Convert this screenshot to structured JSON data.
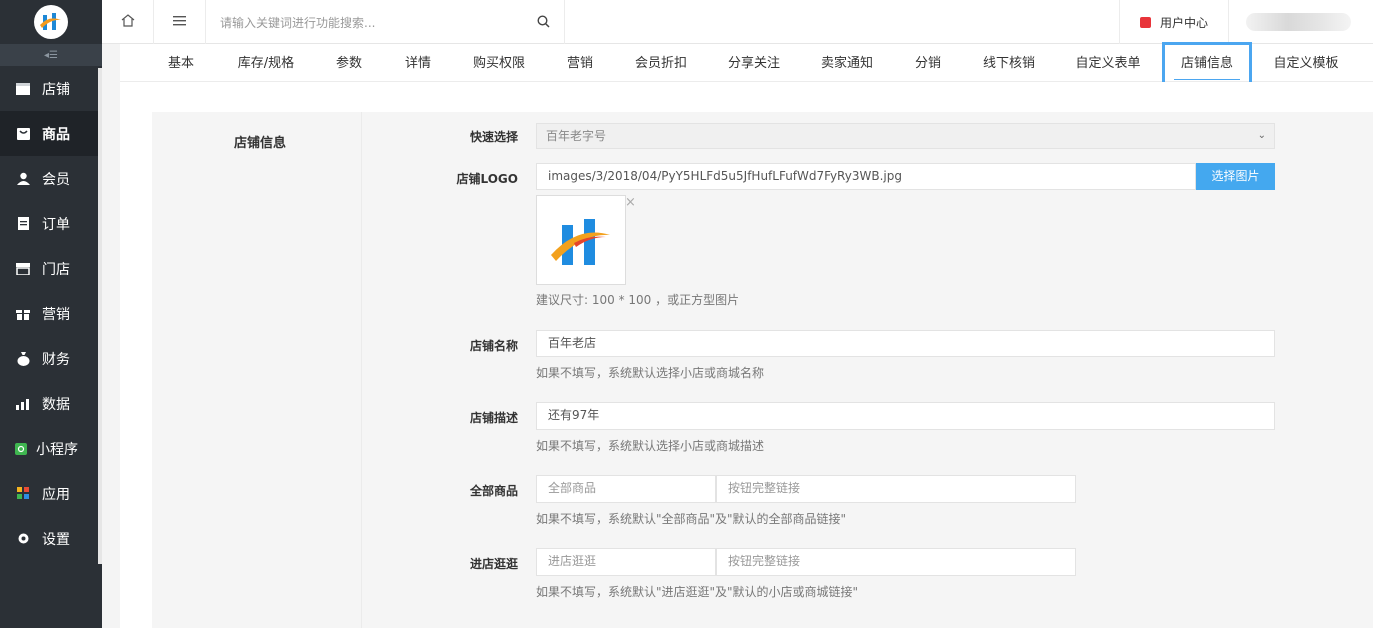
{
  "sidebar": {
    "collapse_icon": "collapse-icon",
    "items": [
      {
        "label": "店铺",
        "icon": "store-icon"
      },
      {
        "label": "商品",
        "icon": "goods-icon",
        "active": true
      },
      {
        "label": "会员",
        "icon": "member-icon"
      },
      {
        "label": "订单",
        "icon": "order-icon"
      },
      {
        "label": "门店",
        "icon": "shop-icon"
      },
      {
        "label": "营销",
        "icon": "gift-icon"
      },
      {
        "label": "财务",
        "icon": "money-bag-icon"
      },
      {
        "label": "数据",
        "icon": "bar-chart-icon"
      },
      {
        "label": "小程序",
        "icon": "mini-program-icon"
      },
      {
        "label": "应用",
        "icon": "apps-icon"
      },
      {
        "label": "设置",
        "icon": "gear-icon"
      }
    ]
  },
  "topbar": {
    "search_placeholder": "请输入关键词进行功能搜索...",
    "user_center_label": "用户中心"
  },
  "tabs": [
    {
      "label": "基本"
    },
    {
      "label": "库存/规格"
    },
    {
      "label": "参数"
    },
    {
      "label": "详情"
    },
    {
      "label": "购买权限"
    },
    {
      "label": "营销"
    },
    {
      "label": "会员折扣"
    },
    {
      "label": "分享关注"
    },
    {
      "label": "卖家通知"
    },
    {
      "label": "分销"
    },
    {
      "label": "线下核销"
    },
    {
      "label": "自定义表单"
    },
    {
      "label": "店铺信息",
      "active": true
    },
    {
      "label": "自定义模板"
    }
  ],
  "form": {
    "section_title": "店铺信息",
    "quick_select": {
      "label": "快速选择",
      "value": "百年老字号"
    },
    "logo": {
      "label": "店铺LOGO",
      "value": "images/3/2018/04/PyY5HLFd5u5JfHufLFufWd7FyRy3WB.jpg",
      "button": "选择图片",
      "remove": "×",
      "hint": "建议尺寸: 100 * 100 ，或正方型图片"
    },
    "name": {
      "label": "店铺名称",
      "value": "百年老店",
      "hint": "如果不填写，系统默认选择小店或商城名称"
    },
    "desc": {
      "label": "店铺描述",
      "value": "还有97年",
      "hint": "如果不填写，系统默认选择小店或商城描述"
    },
    "all_goods": {
      "label": "全部商品",
      "placeholder": "全部商品",
      "link_placeholder": "按钮完整链接",
      "hint": "如果不填写，系统默认\"全部商品\"及\"默认的全部商品链接\""
    },
    "visit_store": {
      "label": "进店逛逛",
      "placeholder": "进店逛逛",
      "link_placeholder": "按钮完整链接",
      "hint": "如果不填写，系统默认\"进店逛逛\"及\"默认的小店或商城链接\""
    }
  }
}
